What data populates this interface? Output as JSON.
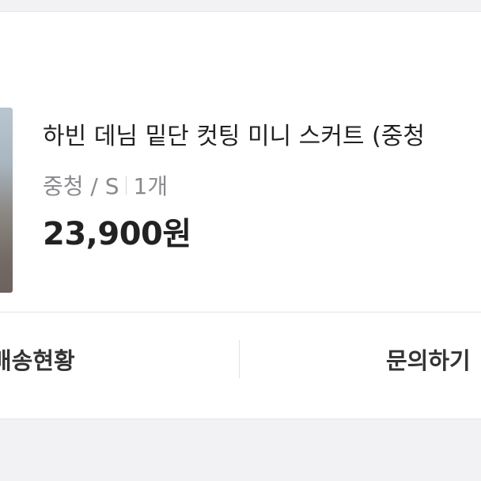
{
  "product": {
    "title": "하빈 데님 밑단 컷팅 미니 스커트 (중청",
    "option_color": "중청 / S",
    "option_qty": "1개",
    "price": "23,900원"
  },
  "actions": {
    "delivery_label": "배송현황",
    "inquiry_label": "문의하기"
  }
}
